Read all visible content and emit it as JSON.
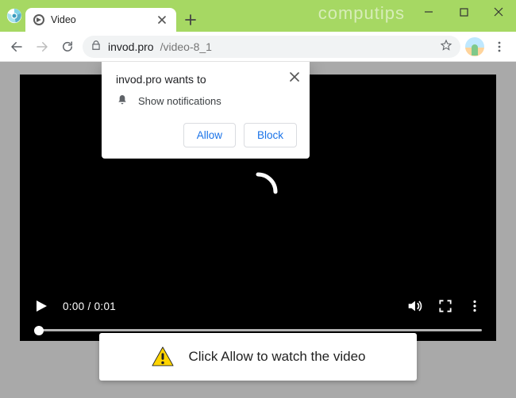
{
  "window": {
    "watermark": "computips"
  },
  "tab": {
    "title": "Video"
  },
  "omnibox": {
    "host": "invod.pro",
    "path": "/video-8_1"
  },
  "player": {
    "time": "0:00 / 0:01"
  },
  "permission": {
    "title": "invod.pro wants to",
    "request": "Show notifications",
    "allow": "Allow",
    "block": "Block"
  },
  "banner": {
    "text": "Click Allow to watch the video"
  }
}
